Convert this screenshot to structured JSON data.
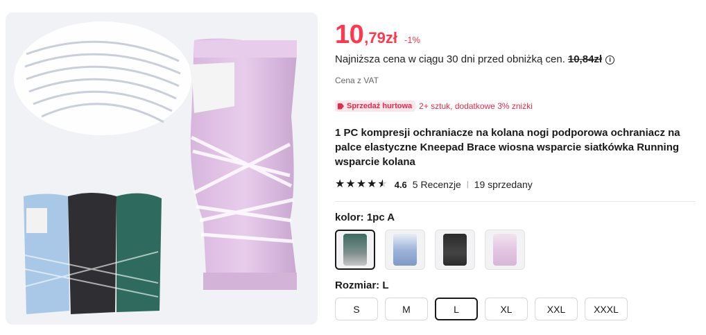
{
  "product_image": {
    "alt": "knee-sleeve-product-photo"
  },
  "price": {
    "integer": "10",
    "decimal": ",79zł",
    "discount": "-1%"
  },
  "lowest_price": {
    "text": "Najniższa cena w ciągu 30 dni przed obniżką cen.",
    "old_price": "10,84zł",
    "info": "i"
  },
  "vat": "Cena z VAT",
  "wholesale": {
    "badge": "Sprzedaż hurtowa",
    "text": "2+ sztuk, dodatkowe 3% zniżki"
  },
  "title": "1 PC kompresji ochraniacze na kolana nogi podporowa ochraniacz na palce elastyczne Kneepad Brace wiosna wsparcie siatkówka Running wsparcie kolana",
  "rating": {
    "stars": "★★★★★",
    "value": "4.6",
    "reviews": "5 Recenzje",
    "separator": "|",
    "sold": "19 sprzedany",
    "filled_fraction": 0.92
  },
  "color": {
    "label": "kolor:",
    "selected": "1pc A",
    "options": [
      {
        "name": "green",
        "accent": "#3a6b62"
      },
      {
        "name": "blue",
        "accent": "#9fb4d9"
      },
      {
        "name": "black",
        "accent": "#2b2b2b"
      },
      {
        "name": "pink",
        "accent": "#e3c6e2"
      }
    ]
  },
  "size": {
    "label": "Rozmiar:",
    "selected": "L",
    "options": [
      "S",
      "M",
      "L",
      "XL",
      "XXL",
      "XXXL"
    ]
  },
  "colors": {
    "price_red": "#fd384f",
    "badge_red": "#e52a4a"
  }
}
